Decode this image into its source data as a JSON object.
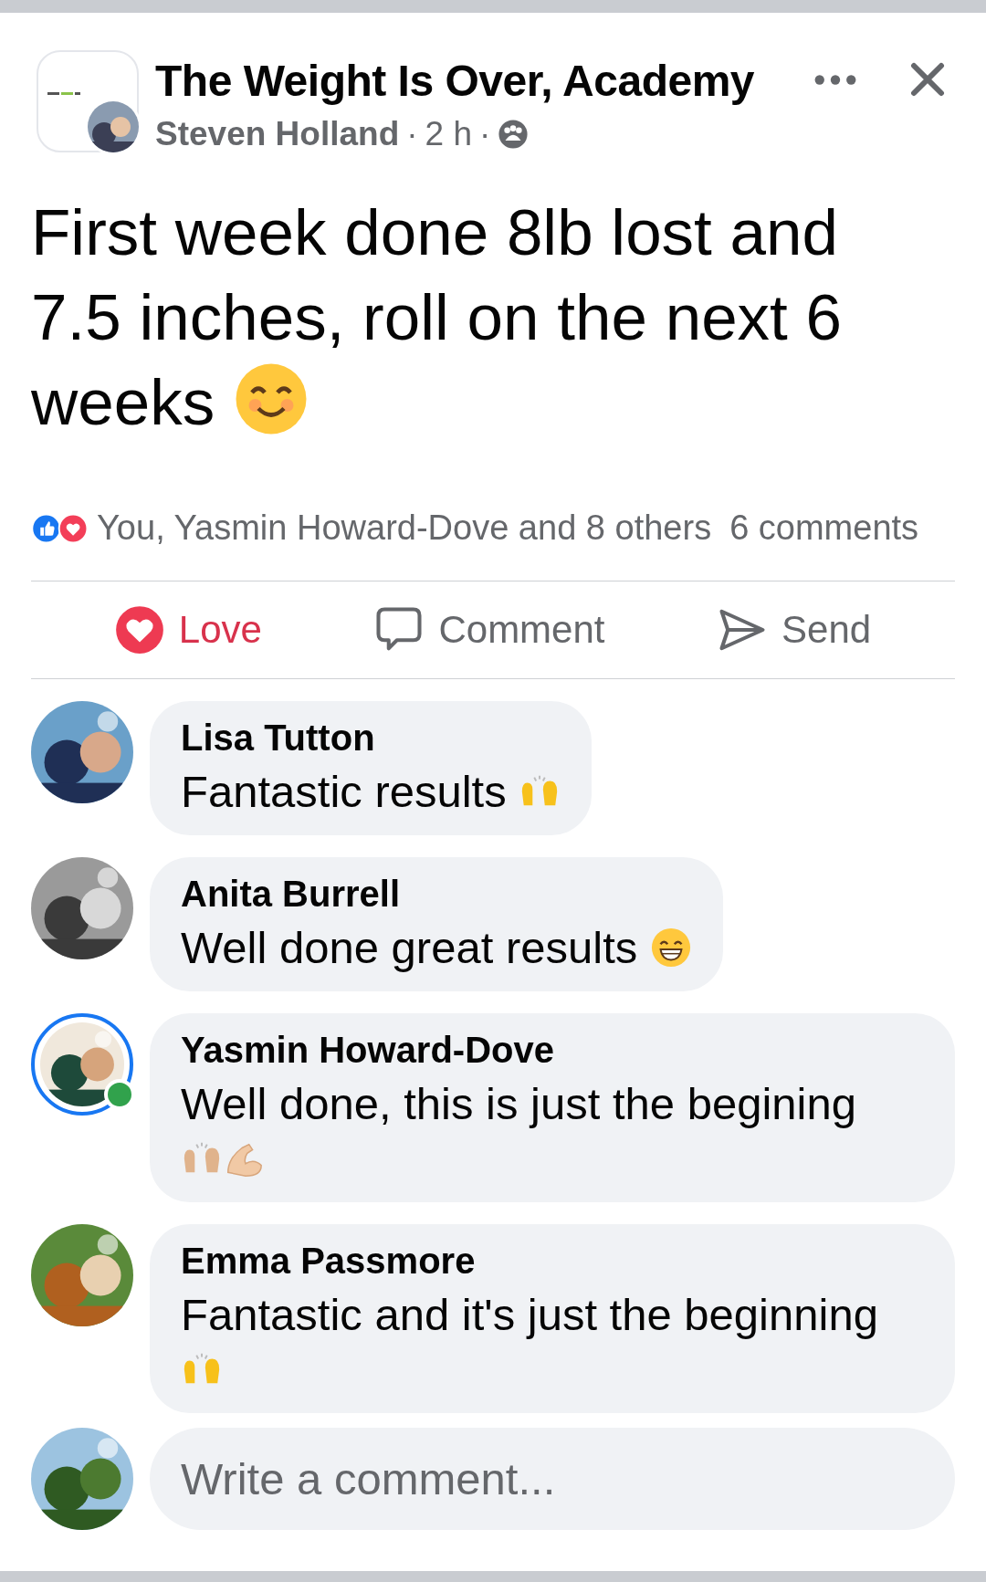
{
  "post": {
    "page_name": "The Weight Is Over, Academy",
    "author": "Steven Holland",
    "time": "2 h",
    "text": "First week done 8lb lost and 7.5 inches, roll on the next 6 weeks",
    "separator": "·",
    "text_emojis": [
      {
        "kind": "smiling-face"
      }
    ]
  },
  "reactions": {
    "summary": "You, Yasmin Howard-Dove and 8 others",
    "comments_count": "6 comments"
  },
  "actions": [
    {
      "kind": "love",
      "label": "Love",
      "selected": true
    },
    {
      "kind": "comment",
      "label": "Comment",
      "selected": false
    },
    {
      "kind": "send",
      "label": "Send",
      "selected": false
    }
  ],
  "comments": [
    {
      "author": "Lisa Tutton",
      "text": "Fantastic results",
      "emojis": [
        {
          "kind": "raised-hands"
        }
      ],
      "online": false,
      "story_ring": false
    },
    {
      "author": "Anita Burrell",
      "text": "Well done great results",
      "emojis": [
        {
          "kind": "grinning-face"
        }
      ],
      "online": false,
      "story_ring": false
    },
    {
      "author": "Yasmin Howard-Dove",
      "text": "Well done, this is just the begining",
      "emojis": [
        {
          "kind": "raised-hands-light"
        },
        {
          "kind": "flexed-arm"
        }
      ],
      "online": true,
      "story_ring": true
    },
    {
      "author": "Emma Passmore",
      "text": "Fantastic and it's just the beginning",
      "emojis": [
        {
          "kind": "raised-hands"
        }
      ],
      "online": false,
      "story_ring": false
    }
  ],
  "composer": {
    "placeholder": "Write a comment..."
  }
}
